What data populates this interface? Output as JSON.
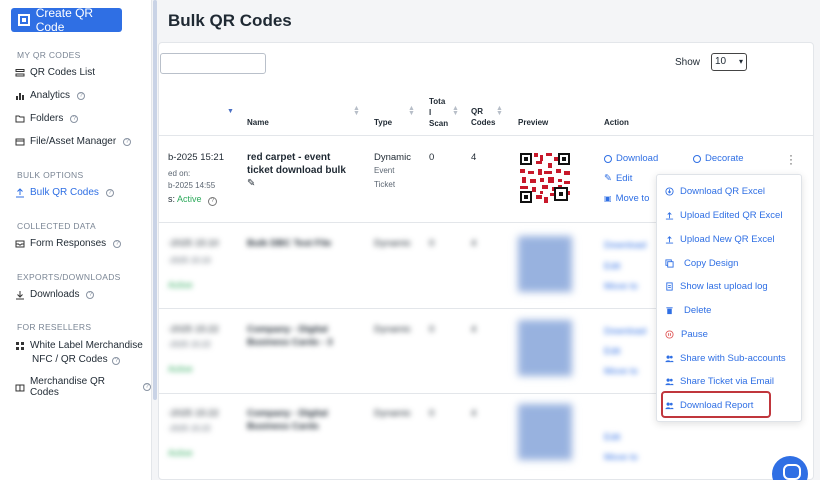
{
  "sidebar": {
    "create_label": "Create QR Code",
    "sections": [
      {
        "title": "MY QR CODES",
        "items": [
          "QR Codes List",
          "Analytics",
          "Folders",
          "File/Asset Manager"
        ]
      },
      {
        "title": "BULK OPTIONS",
        "items": [
          "Bulk QR Codes"
        ]
      },
      {
        "title": "COLLECTED DATA",
        "items": [
          "Form Responses"
        ]
      },
      {
        "title": "EXPORTS/DOWNLOADS",
        "items": [
          "Downloads"
        ]
      },
      {
        "title": "FOR RESELLERS",
        "items": [
          "White Label Merchandise",
          "NFC / QR Codes",
          "Merchandise QR Codes"
        ]
      }
    ],
    "help_glyph": "?",
    "active_item": "Bulk QR Codes"
  },
  "page": {
    "title": "Bulk QR Codes"
  },
  "controls": {
    "show_label": "Show",
    "show_value": "10"
  },
  "table": {
    "headers": [
      "Name",
      "Type",
      "Tota",
      "l",
      "Scan",
      "QR",
      "Codes",
      "Preview",
      "Action"
    ],
    "row1": {
      "date": "b-2025 15:21",
      "created_label": "ed on:",
      "created_value": "b-2025 14:55",
      "status_label": "s:",
      "status_value": "Active",
      "name_line1": "red carpet - event",
      "name_line2": "ticket download bulk",
      "type_main": "Dynamic",
      "type_sub1": "Event",
      "type_sub2": "Ticket",
      "total_scan": "0",
      "qr_codes": "4",
      "actions": [
        "Download",
        "Decorate",
        "Edit",
        "Move to"
      ]
    },
    "blurred_rows": [
      {
        "date": "-2025 15:10",
        "name": "Bulk DBC Test File",
        "type": "Dynamic",
        "scan": "0",
        "codes": "4"
      },
      {
        "date": "-2025 15:22",
        "name": "Company - Digital",
        "name2": "Business Cards - 3",
        "type": "Dynamic",
        "scan": "0",
        "codes": "4"
      },
      {
        "date": "-2025 15:22",
        "name": "Company - Digital",
        "name2": "Business Cards",
        "type": "Dynamic",
        "scan": "0",
        "codes": "4"
      }
    ],
    "blur_actions": [
      "Download",
      "Edit",
      "Move to"
    ]
  },
  "menu": {
    "items": [
      {
        "label": "Download QR Excel",
        "icon": "download-icon"
      },
      {
        "label": "Upload Edited QR Excel",
        "icon": "upload-icon"
      },
      {
        "label": "Upload New QR Excel",
        "icon": "upload-icon"
      },
      {
        "label": "Copy Design",
        "icon": "copy-icon"
      },
      {
        "label": "Show last upload log",
        "icon": "document-icon"
      },
      {
        "label": "Delete",
        "icon": "trash-icon"
      },
      {
        "label": "Pause",
        "icon": "pause-icon"
      },
      {
        "label": "Share with Sub-accounts",
        "icon": "users-icon"
      },
      {
        "label": "Share Ticket via Email",
        "icon": "users-icon"
      },
      {
        "label": "Download Report",
        "icon": "users-icon"
      }
    ]
  },
  "colors": {
    "accent": "#2f6fe4",
    "active": "#2eaa5c",
    "highlight": "#c0363c",
    "qr": "#c8182a"
  }
}
